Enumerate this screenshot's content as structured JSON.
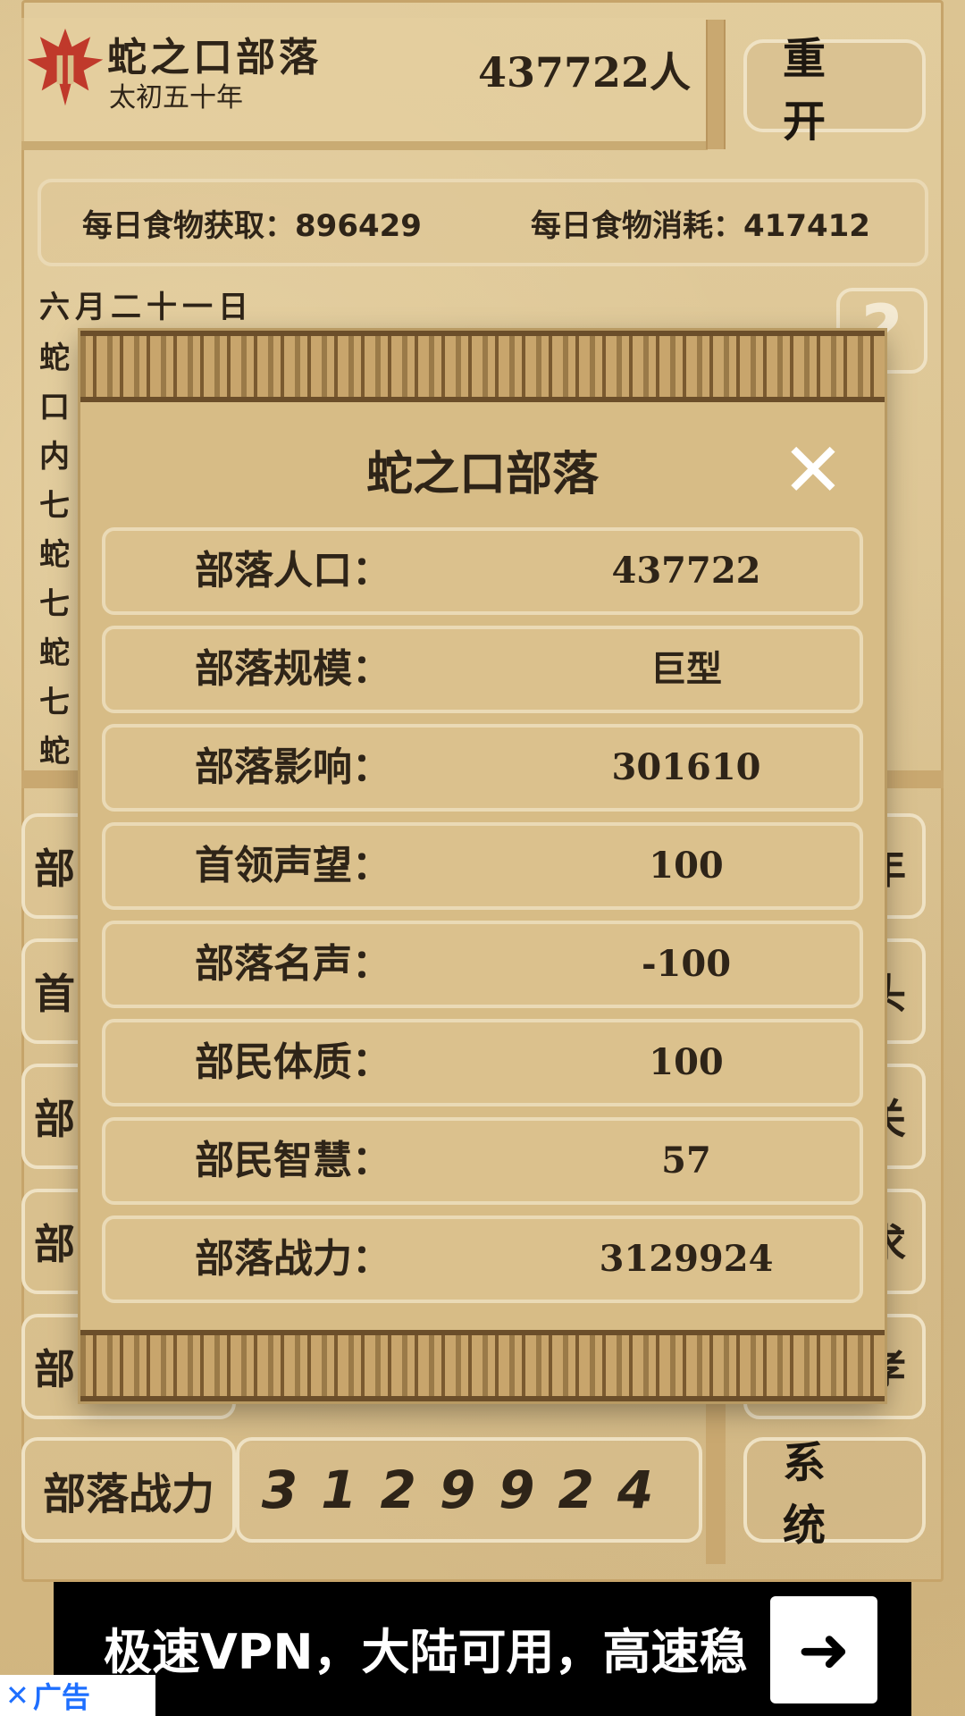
{
  "header": {
    "tribe_name": "蛇之口部落",
    "era": "太初五十年",
    "population": "437722人",
    "restart_label": "重 开"
  },
  "food": {
    "income_label": "每日食物获取：896429",
    "consume_label": "每日食物消耗：417412"
  },
  "date": "六月二十一日",
  "log_chars": [
    "蛇",
    "口",
    "内",
    "七",
    "蛇",
    "七",
    "蛇",
    "七",
    "蛇"
  ],
  "left_buttons": [
    "部",
    "首",
    "部",
    "部",
    "部"
  ],
  "right_buttons": [
    "年",
    "头",
    "关",
    "求",
    "孝"
  ],
  "bottom": {
    "power_label": "部落战力",
    "power_value": "3129924",
    "system_label": "系 统"
  },
  "modal": {
    "title": "蛇之口部落",
    "close_icon": "close-x",
    "rows": [
      {
        "label": "部落人口：",
        "value": "437722"
      },
      {
        "label": "部落规模：",
        "value": "巨型"
      },
      {
        "label": "部落影响：",
        "value": "301610"
      },
      {
        "label": "首领声望：",
        "value": "100"
      },
      {
        "label": "部落名声：",
        "value": "-100"
      },
      {
        "label": "部民体质：",
        "value": "100"
      },
      {
        "label": "部民智慧：",
        "value": "57"
      },
      {
        "label": "部落战力：",
        "value": "3129924"
      }
    ]
  },
  "ad": {
    "text": "极速VPN，大陆可用，高速稳",
    "tag": "广告"
  },
  "colors": {
    "emblem": "#c0392b",
    "parchment": "#d7bc86",
    "ad_bg": "#000000"
  }
}
